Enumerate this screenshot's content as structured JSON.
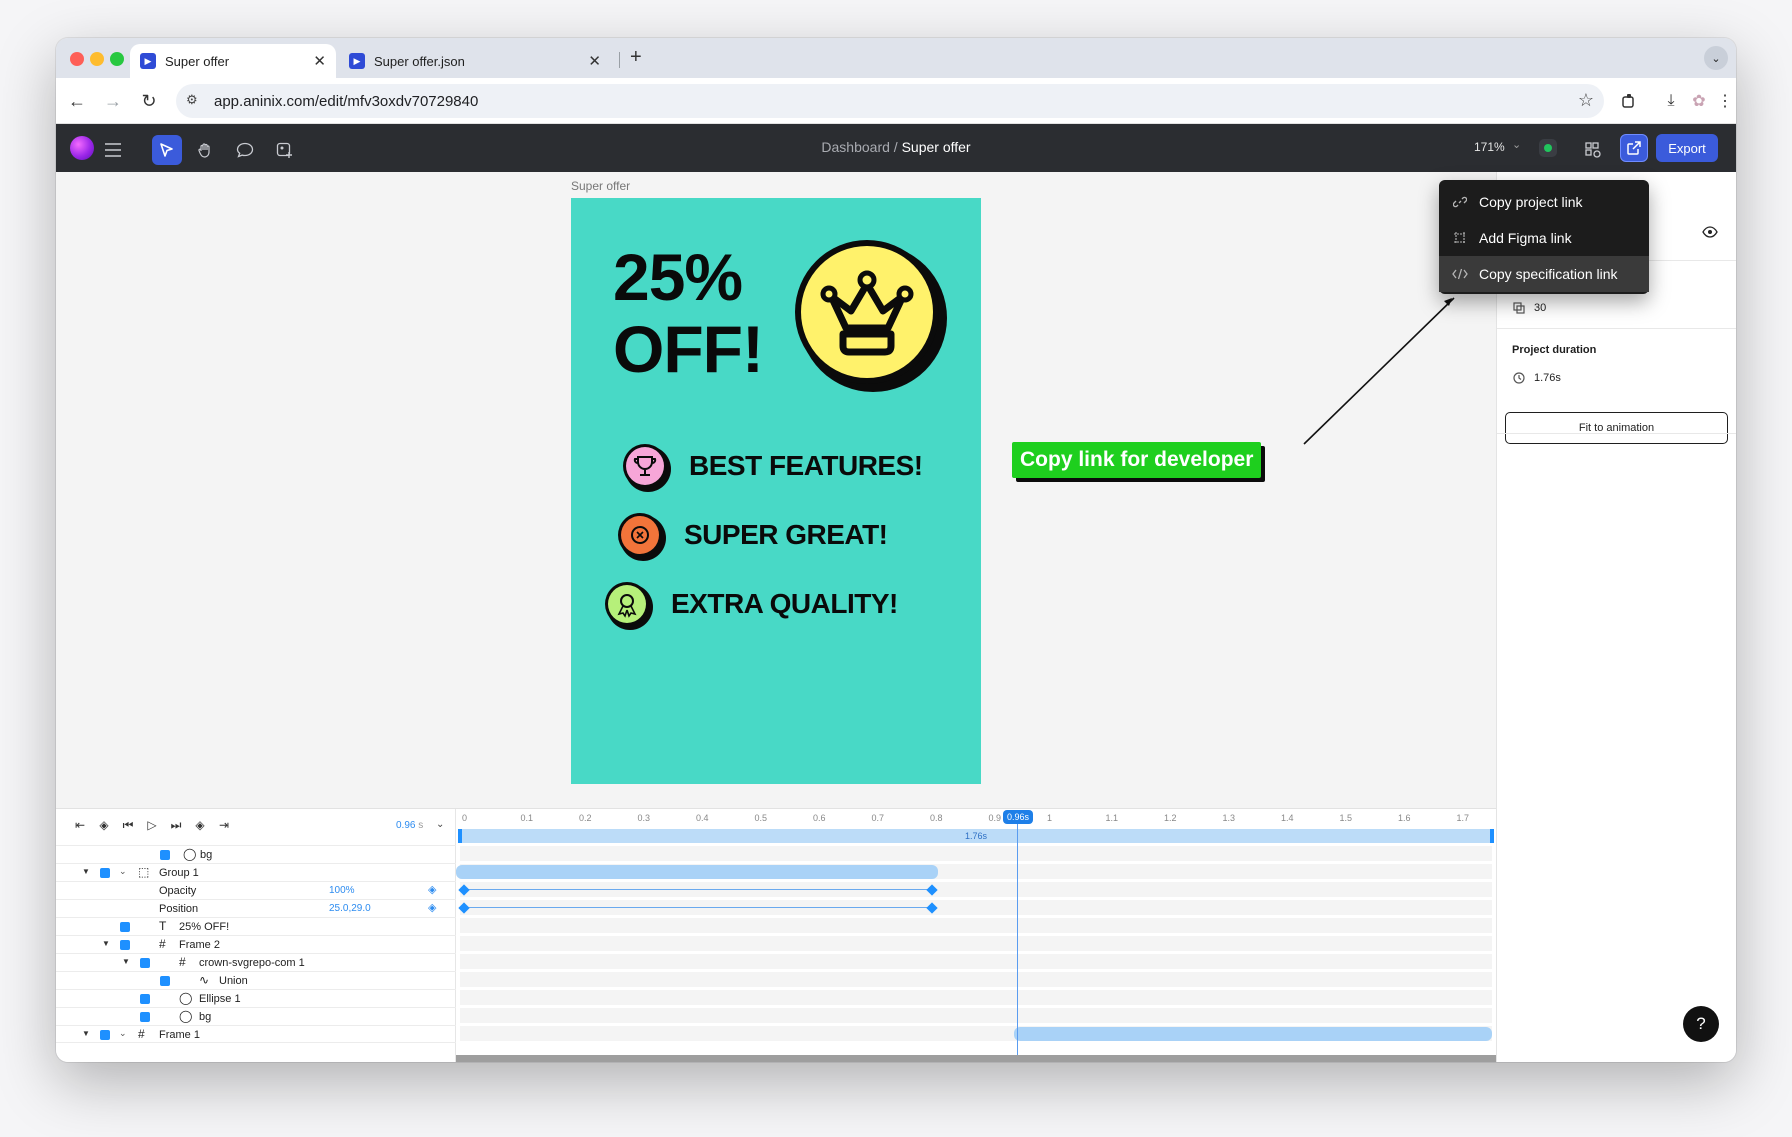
{
  "browser": {
    "tabs": [
      {
        "title": "Super offer",
        "active": true
      },
      {
        "title": "Super offer.json",
        "active": false
      }
    ],
    "url": "app.aninix.com/edit/mfv3oxdv70729840"
  },
  "app": {
    "breadcrumb_root": "Dashboard",
    "breadcrumb_sep": "/",
    "breadcrumb_current": "Super offer",
    "zoom": "171%",
    "export_label": "Export"
  },
  "canvas": {
    "frame_label": "Super offer",
    "headline_line1": "25%",
    "headline_line2": "OFF!",
    "features": [
      "BEST FEATURES!",
      "SUPER GREAT!",
      "EXTRA QUALITY!"
    ],
    "callout": "Copy link for developer",
    "bg_color": "#48d9c6"
  },
  "share_menu": {
    "items": [
      "Copy project link",
      "Add Figma link",
      "Copy specification link"
    ]
  },
  "right_panel": {
    "fps": "30",
    "duration_title": "Project duration",
    "duration": "1.76s",
    "fit_button": "Fit to animation",
    "help": "?"
  },
  "timeline": {
    "current_time": "0.96",
    "time_unit": "s",
    "playhead_label": "0.96s",
    "total_label": "1.76s",
    "ruler": [
      "0",
      "0.1",
      "0.2",
      "0.3",
      "0.4",
      "0.5",
      "0.6",
      "0.7",
      "0.8",
      "0.9",
      "1",
      "1.1",
      "1.2",
      "1.3",
      "1.4",
      "1.5",
      "1.6",
      "1.7"
    ],
    "layers": [
      {
        "name": "bg"
      },
      {
        "name": "Group 1"
      },
      {
        "name": "Opacity",
        "value": "100%"
      },
      {
        "name": "Position",
        "value": "25.0,29.0"
      },
      {
        "name": "25% OFF!"
      },
      {
        "name": "Frame 2"
      },
      {
        "name": "crown-svgrepo-com 1"
      },
      {
        "name": "Union"
      },
      {
        "name": "Ellipse 1"
      },
      {
        "name": "bg"
      },
      {
        "name": "Frame 1"
      }
    ]
  }
}
